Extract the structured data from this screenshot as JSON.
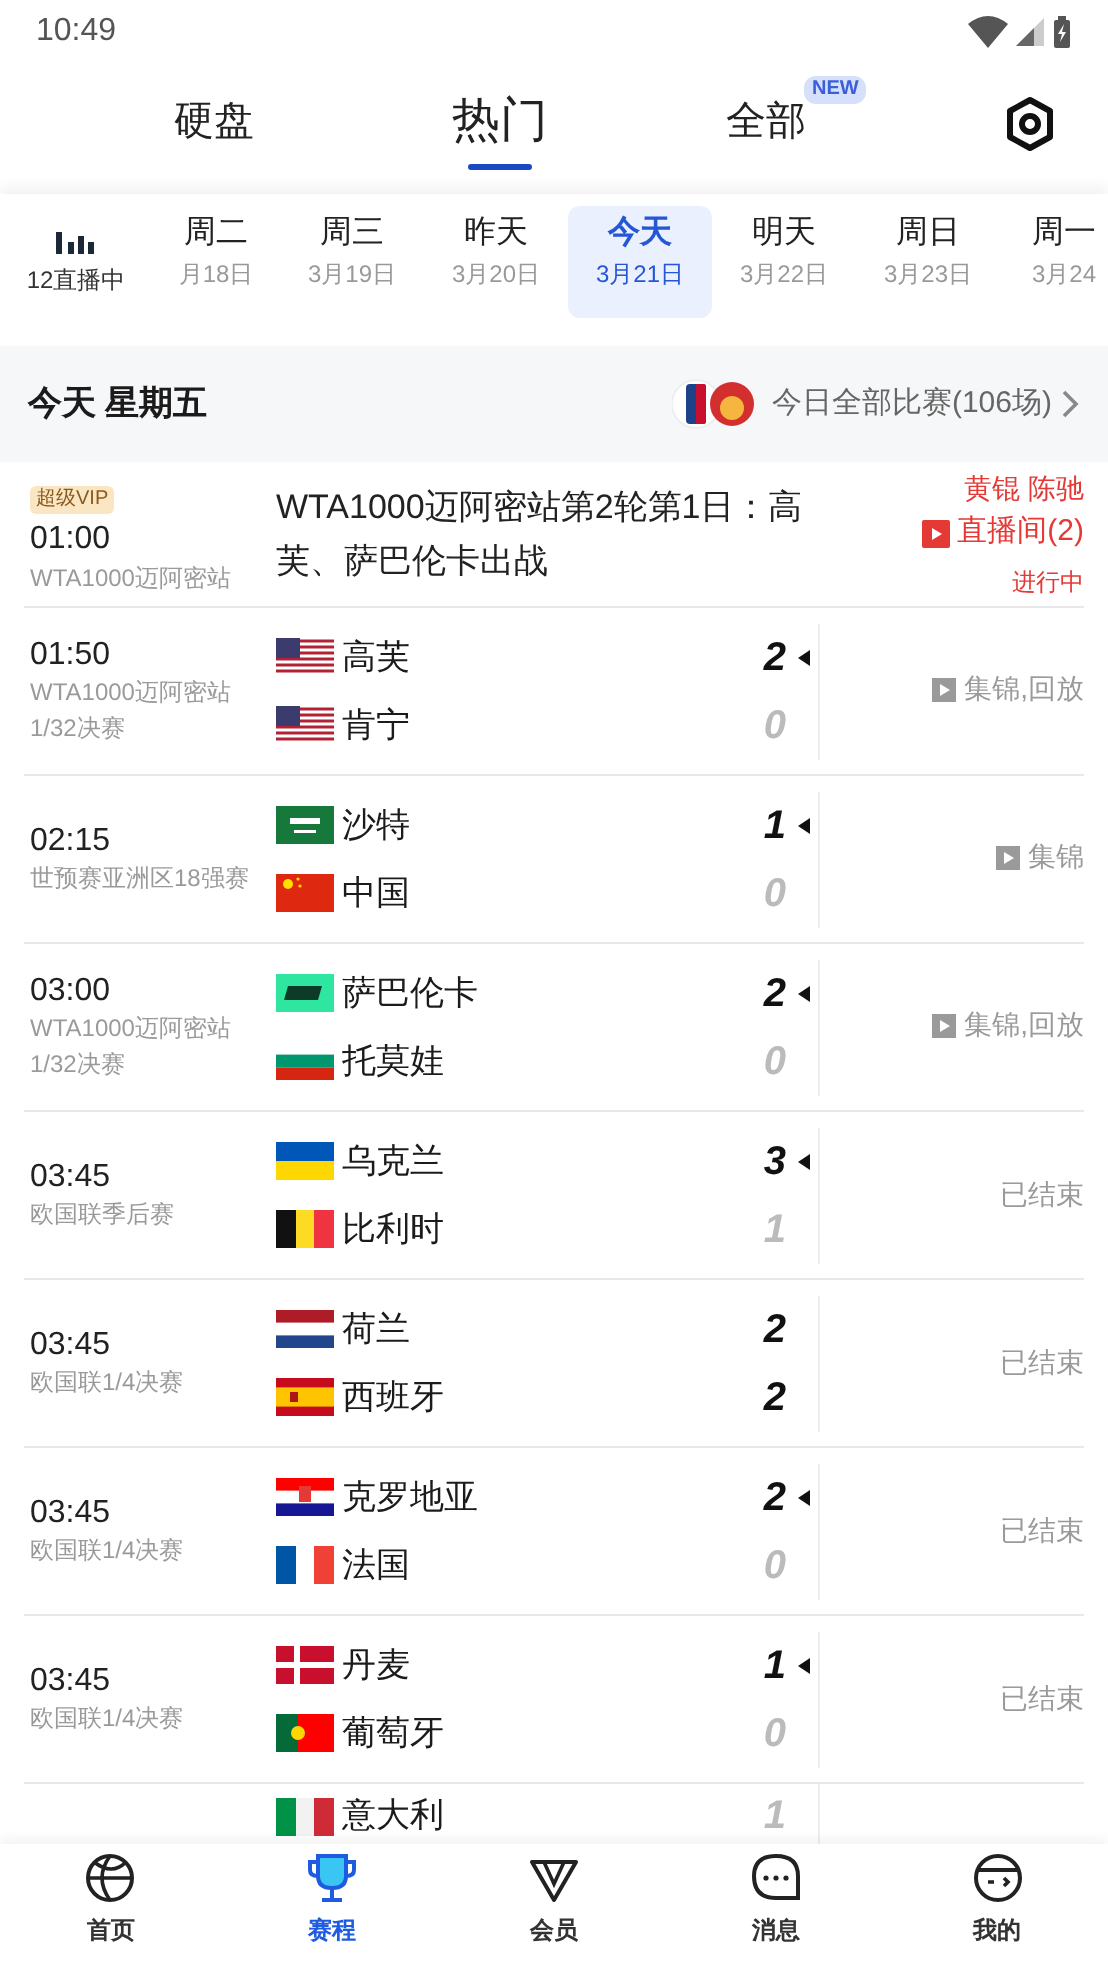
{
  "status_bar": {
    "time": "10:49"
  },
  "top_tabs": [
    {
      "label": "硬盘",
      "selected": false
    },
    {
      "label": "热门",
      "selected": true
    },
    {
      "label": "全部",
      "selected": false,
      "badge": "NEW"
    }
  ],
  "live_count": "12直播中",
  "dates": [
    {
      "day": "周二",
      "date": "月18日",
      "selected": false
    },
    {
      "day": "周三",
      "date": "3月19日",
      "selected": false
    },
    {
      "day": "昨天",
      "date": "3月20日",
      "selected": false
    },
    {
      "day": "今天",
      "date": "3月21日",
      "selected": true
    },
    {
      "day": "明天",
      "date": "3月22日",
      "selected": false
    },
    {
      "day": "周日",
      "date": "3月23日",
      "selected": false
    },
    {
      "day": "周一",
      "date": "3月24",
      "selected": false
    }
  ],
  "day_header": {
    "title": "今天 星期五",
    "all_games": "今日全部比赛(106场)"
  },
  "matches": [
    {
      "kind": "event",
      "badge": "超级VIP",
      "time": "01:00",
      "league": "WTA1000迈阿密站",
      "title": "WTA1000迈阿密站第2轮第1日：高芙、萨巴伦卡出战",
      "commentators": "黄锟 陈驰",
      "live_room": "直播间(2)",
      "status": "进行中"
    },
    {
      "kind": "game",
      "time": "01:50",
      "league": "WTA1000迈阿密站",
      "round": "1/32决赛",
      "teams": [
        {
          "name": "高芙",
          "kind": "us",
          "score": "2",
          "bold": true,
          "winner": true
        },
        {
          "name": "肯宁",
          "kind": "us",
          "score": "0",
          "bold": false,
          "winner": false
        }
      ],
      "side": {
        "kind": "video",
        "text": "集锦,回放"
      }
    },
    {
      "kind": "game",
      "time": "02:15",
      "league": "世预赛亚洲区18强赛",
      "teams": [
        {
          "name": "沙特",
          "kind": "sa",
          "score": "1",
          "bold": true,
          "winner": true
        },
        {
          "name": "中国",
          "kind": "cn",
          "score": "0",
          "bold": false,
          "winner": false
        }
      ],
      "side": {
        "kind": "video",
        "text": "集锦"
      }
    },
    {
      "kind": "game",
      "time": "03:00",
      "league": "WTA1000迈阿密站",
      "round": "1/32决赛",
      "teams": [
        {
          "name": "萨巴伦卡",
          "kind": "wta",
          "score": "2",
          "bold": true,
          "winner": true
        },
        {
          "name": "托莫娃",
          "kind": "bg",
          "score": "0",
          "bold": false,
          "winner": false
        }
      ],
      "side": {
        "kind": "video",
        "text": "集锦,回放"
      }
    },
    {
      "kind": "game",
      "time": "03:45",
      "league": "欧国联季后赛",
      "teams": [
        {
          "name": "乌克兰",
          "kind": "ua",
          "score": "3",
          "bold": true,
          "winner": true
        },
        {
          "name": "比利时",
          "kind": "be",
          "score": "1",
          "bold": false,
          "winner": false
        }
      ],
      "side": {
        "kind": "status",
        "text": "已结束"
      }
    },
    {
      "kind": "game",
      "time": "03:45",
      "league": "欧国联1/4决赛",
      "teams": [
        {
          "name": "荷兰",
          "kind": "nl",
          "score": "2",
          "bold": true,
          "winner": false
        },
        {
          "name": "西班牙",
          "kind": "es",
          "score": "2",
          "bold": true,
          "winner": false
        }
      ],
      "side": {
        "kind": "status",
        "text": "已结束"
      }
    },
    {
      "kind": "game",
      "time": "03:45",
      "league": "欧国联1/4决赛",
      "teams": [
        {
          "name": "克罗地亚",
          "kind": "hr",
          "score": "2",
          "bold": true,
          "winner": true
        },
        {
          "name": "法国",
          "kind": "fr",
          "score": "0",
          "bold": false,
          "winner": false
        }
      ],
      "side": {
        "kind": "status",
        "text": "已结束"
      }
    },
    {
      "kind": "game",
      "time": "03:45",
      "league": "欧国联1/4决赛",
      "teams": [
        {
          "name": "丹麦",
          "kind": "dk",
          "score": "1",
          "bold": true,
          "winner": true
        },
        {
          "name": "葡萄牙",
          "kind": "pt",
          "score": "0",
          "bold": false,
          "winner": false
        }
      ],
      "side": {
        "kind": "status",
        "text": "已结束"
      }
    },
    {
      "kind": "game",
      "teams": [
        {
          "name": "意大利",
          "kind": "it",
          "score": "1",
          "bold": false,
          "winner": false
        }
      ]
    }
  ],
  "bottom_nav": [
    {
      "label": "首页",
      "selected": false
    },
    {
      "label": "赛程",
      "selected": true
    },
    {
      "label": "会员",
      "selected": false
    },
    {
      "label": "消息",
      "selected": false
    },
    {
      "label": "我的",
      "selected": false
    }
  ]
}
